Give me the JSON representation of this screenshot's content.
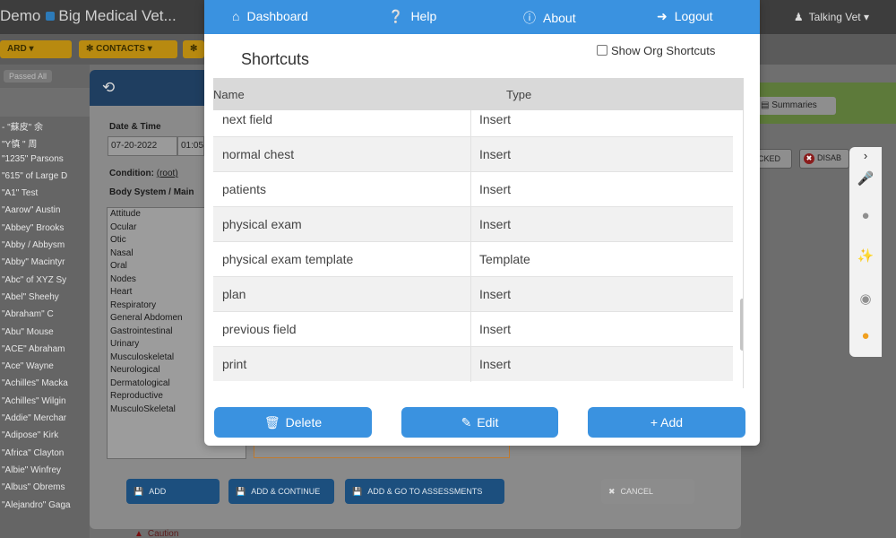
{
  "app": {
    "title_prefix": "Demo",
    "practice_name": "Big Medical Vet...",
    "user_icon": "user-icon",
    "user_name": "Talking Vet",
    "user_caret": "▾",
    "subtabs": [
      "ARD",
      "CONTACTS",
      ""
    ],
    "filter_text": "Passed All"
  },
  "patients": [
    "- \"蘇皮\" 余",
    "\"Y慎 \" 周",
    "\"1235\" Parsons",
    "\"615\" of Large D",
    "\"A1\" Test",
    "\"Aarow\" Austin",
    "\"Abbey\" Brooks",
    "\"Abby / Abbysm",
    "\"Abby\" Macintyr",
    "\"Abc\" of XYZ Sy",
    "\"Abel\" Sheehy",
    "\"Abraham\" C",
    "\"Abu\" Mouse",
    "\"ACE\" Abraham",
    "\"Ace\" Wayne",
    "\"Achilles\" Macka",
    "\"Achilles\" Wilgin",
    "\"Addie\" Merchar",
    "\"Adipose\" Kirk",
    "\"Africa\" Clayton",
    "\"Albie\" Winfrey",
    "\"Albus\" Obrems",
    "\"Alejandro\" Gaga"
  ],
  "condition_form": {
    "history_icon": "history-icon",
    "date_time_label": "Date & Time",
    "date_value": "07-20-2022",
    "time_value": "01:05",
    "condition_label": "Condition:",
    "condition_root": "(root)",
    "body_system_label": "Body System / Main",
    "body_systems": [
      "Attitude",
      "Ocular",
      "Otic",
      "Nasal",
      "Oral",
      "Nodes",
      "Heart",
      "Respiratory",
      "General Abdomen",
      "Gastrointestinal",
      "Urinary",
      "Musculoskeletal",
      "Neurological",
      "Dermatological",
      "Reproductive",
      "MusculoSkeletal"
    ],
    "buttons": {
      "add": "ADD",
      "add_continue": "ADD & CONTINUE",
      "add_go_assessments": "ADD & GO TO ASSESSMENTS",
      "cancel": "CANCEL"
    },
    "caution_text": "Caution"
  },
  "right_panel": {
    "summaries": "Summaries",
    "locked": "OCKED",
    "disable": "DISAB",
    "tool_icons": [
      "chevron-right-icon",
      "microphone-icon",
      "chat-icon",
      "magic-wand-icon",
      "compass-icon",
      "lightbulb-icon"
    ]
  },
  "shortcuts_modal": {
    "nav": {
      "dashboard": "Dashboard",
      "help": "Help",
      "about": "About",
      "logout": "Logout"
    },
    "title": "Shortcuts",
    "show_org_label": "Show Org Shortcuts",
    "show_org_checked": false,
    "columns": [
      "Name",
      "Type"
    ],
    "rows": [
      {
        "name": "next field",
        "type": "Insert"
      },
      {
        "name": "normal chest",
        "type": "Insert"
      },
      {
        "name": "patients",
        "type": "Insert"
      },
      {
        "name": "physical exam",
        "type": "Insert"
      },
      {
        "name": "physical exam template",
        "type": "Template"
      },
      {
        "name": "plan",
        "type": "Insert"
      },
      {
        "name": "previous field",
        "type": "Insert"
      },
      {
        "name": "print",
        "type": "Insert"
      }
    ],
    "buttons": {
      "delete": "Delete",
      "edit": "Edit",
      "add": "+ Add"
    }
  }
}
